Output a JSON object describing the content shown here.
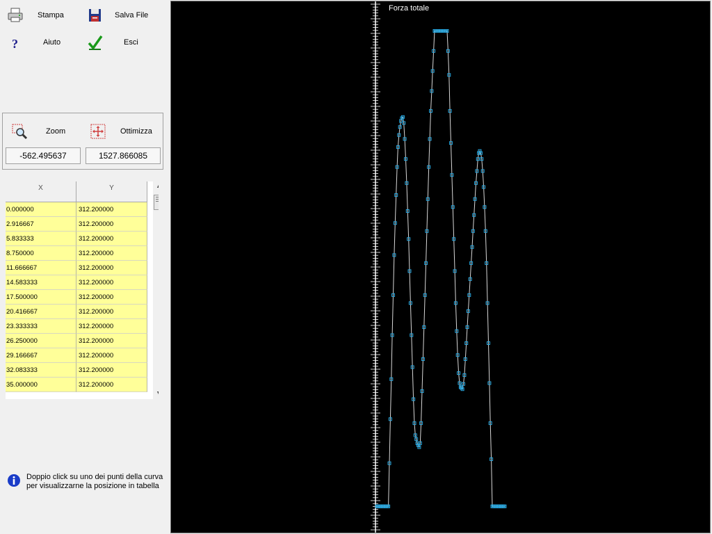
{
  "toolbar": {
    "print_label": "Stampa",
    "save_label": "Salva File",
    "help_label": "Aiuto",
    "exit_label": "Esci"
  },
  "zoom_group": {
    "zoom_label": "Zoom",
    "optimize_label": "Ottimizza",
    "x_value": "-562.495637",
    "y_value": "1527.866085"
  },
  "table": {
    "columns": [
      "X",
      "Y"
    ],
    "rows": [
      [
        "0.000000",
        "312.200000"
      ],
      [
        "2.916667",
        "312.200000"
      ],
      [
        "5.833333",
        "312.200000"
      ],
      [
        "8.750000",
        "312.200000"
      ],
      [
        "11.666667",
        "312.200000"
      ],
      [
        "14.583333",
        "312.200000"
      ],
      [
        "17.500000",
        "312.200000"
      ],
      [
        "20.416667",
        "312.200000"
      ],
      [
        "23.333333",
        "312.200000"
      ],
      [
        "26.250000",
        "312.200000"
      ],
      [
        "29.166667",
        "312.200000"
      ],
      [
        "32.083333",
        "312.200000"
      ],
      [
        "35.000000",
        "312.200000"
      ]
    ]
  },
  "info": {
    "text": "Doppio click su uno dei punti della curva per visualizzarne la posizione in tabella"
  },
  "chart": {
    "title": "Forza totale",
    "colors": {
      "background": "#000000",
      "line": "#d8d8d8",
      "marker": "#29a8e0",
      "axis": "#ffffff"
    }
  },
  "chart_data": {
    "type": "line",
    "title": "Forza totale",
    "series": [
      {
        "values": [
          312.2,
          312.2,
          312.2,
          312.2,
          312.2,
          312.2,
          312.2,
          312.2,
          312.2,
          312.2,
          312.2,
          312.2,
          312.2,
          420,
          530,
          630,
          740,
          840,
          940,
          1020,
          1090,
          1160,
          1210,
          1240,
          1260,
          1275,
          1282,
          1285,
          1270,
          1230,
          1180,
          1120,
          1050,
          980,
          900,
          820,
          740,
          660,
          580,
          520,
          490,
          480,
          470,
          465,
          460,
          470,
          520,
          600,
          680,
          760,
          840,
          920,
          1000,
          1080,
          1160,
          1230,
          1300,
          1350,
          1400,
          1450,
          1500,
          1500,
          1500,
          1500,
          1500,
          1500,
          1500,
          1500,
          1500,
          1500,
          1500,
          1500,
          1500,
          1500,
          1450,
          1390,
          1300,
          1220,
          1140,
          1060,
          980,
          900,
          820,
          750,
          690,
          645,
          620,
          610,
          608,
          605,
          618,
          640,
          680,
          720,
          760,
          800,
          840,
          880,
          920,
          960,
          1000,
          1040,
          1080,
          1120,
          1150,
          1180,
          1195,
          1200,
          1195,
          1180,
          1150,
          1110,
          1060,
          1000,
          920,
          820,
          720,
          620,
          520,
          430,
          312.2,
          312.2,
          312.2,
          312.2,
          312.2,
          312.2,
          312.2,
          312.2,
          312.2,
          312.2,
          312.2,
          312.2,
          312.2,
          312.2
        ]
      }
    ],
    "ylim": [
      250,
      1560
    ],
    "grid": false,
    "legend": "none"
  }
}
